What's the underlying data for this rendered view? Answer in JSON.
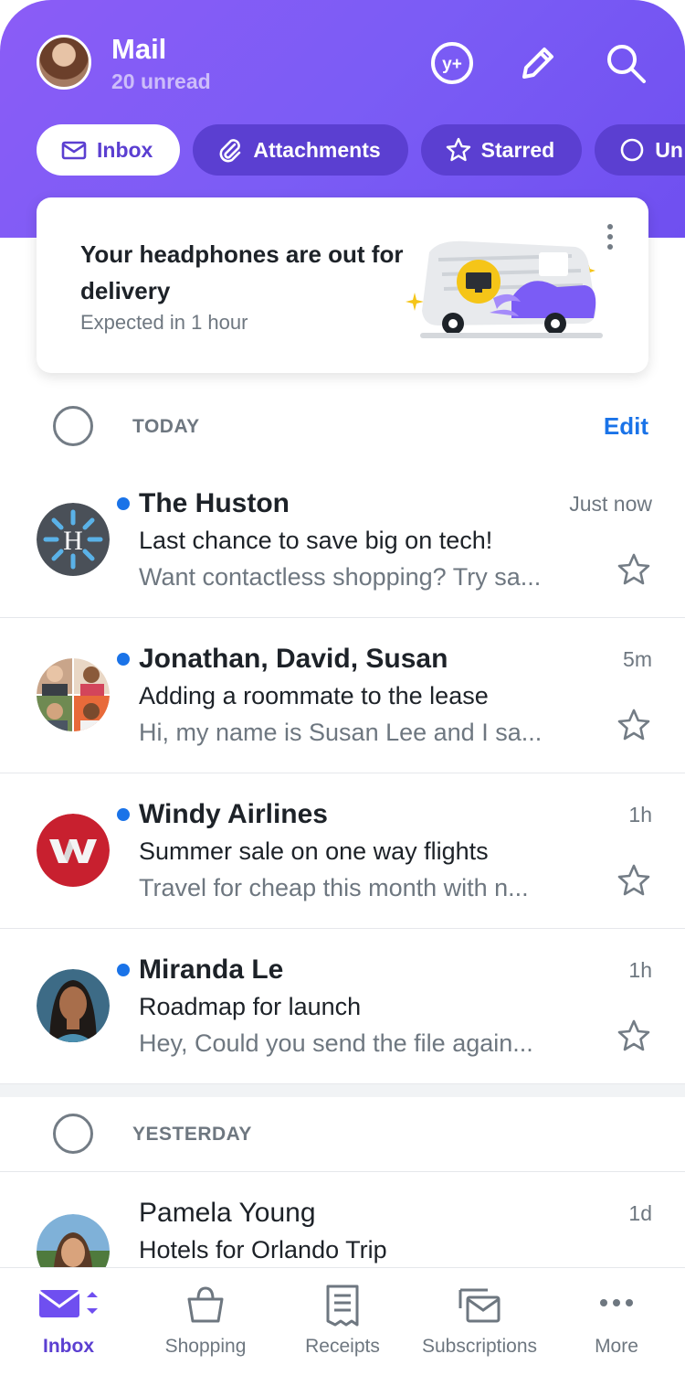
{
  "header": {
    "title": "Mail",
    "unread": "20 unread",
    "icons": [
      "yahoo-plus-icon",
      "compose-icon",
      "search-icon"
    ]
  },
  "filters": [
    {
      "label": "Inbox",
      "icon": "envelope-icon",
      "active": true
    },
    {
      "label": "Attachments",
      "icon": "paperclip-icon",
      "active": false
    },
    {
      "label": "Starred",
      "icon": "star-icon",
      "active": false
    },
    {
      "label": "Un",
      "icon": "circle-icon",
      "active": false
    }
  ],
  "delivery_card": {
    "title": "Your headphones are out for delivery",
    "subtitle": "Expected in 1 hour"
  },
  "sections": {
    "today": {
      "label": "TODAY",
      "edit": "Edit"
    },
    "yesterday": {
      "label": "YESTERDAY"
    }
  },
  "emails": [
    {
      "sender": "The Huston",
      "time": "Just now",
      "subject": "Last chance to save big on tech!",
      "preview": "Want contactless shopping? Try sa...",
      "unread": true
    },
    {
      "sender": "Jonathan, David, Susan",
      "time": "5m",
      "subject": "Adding a roommate to the lease",
      "preview": "Hi, my name is Susan Lee and I sa...",
      "unread": true
    },
    {
      "sender": "Windy Airlines",
      "time": "1h",
      "subject": "Summer sale on one way flights",
      "preview": "Travel for cheap this month with n...",
      "unread": true
    },
    {
      "sender": "Miranda Le",
      "time": "1h",
      "subject": "Roadmap for launch",
      "preview": "Hey, Could you send the file again...",
      "unread": true
    },
    {
      "sender": "Pamela Young",
      "time": "1d",
      "subject": "Hotels for Orlando Trip",
      "preview": "",
      "unread": false
    }
  ],
  "nav": [
    {
      "label": "Inbox",
      "icon": "inbox-icon",
      "active": true
    },
    {
      "label": "Shopping",
      "icon": "shopping-bag-icon",
      "active": false
    },
    {
      "label": "Receipts",
      "icon": "receipt-icon",
      "active": false
    },
    {
      "label": "Subscriptions",
      "icon": "subscriptions-icon",
      "active": false
    },
    {
      "label": "More",
      "icon": "more-icon",
      "active": false
    }
  ],
  "colors": {
    "brand": "#7b5cf5",
    "accent": "#5b3fd1",
    "link": "#1a73e8"
  }
}
